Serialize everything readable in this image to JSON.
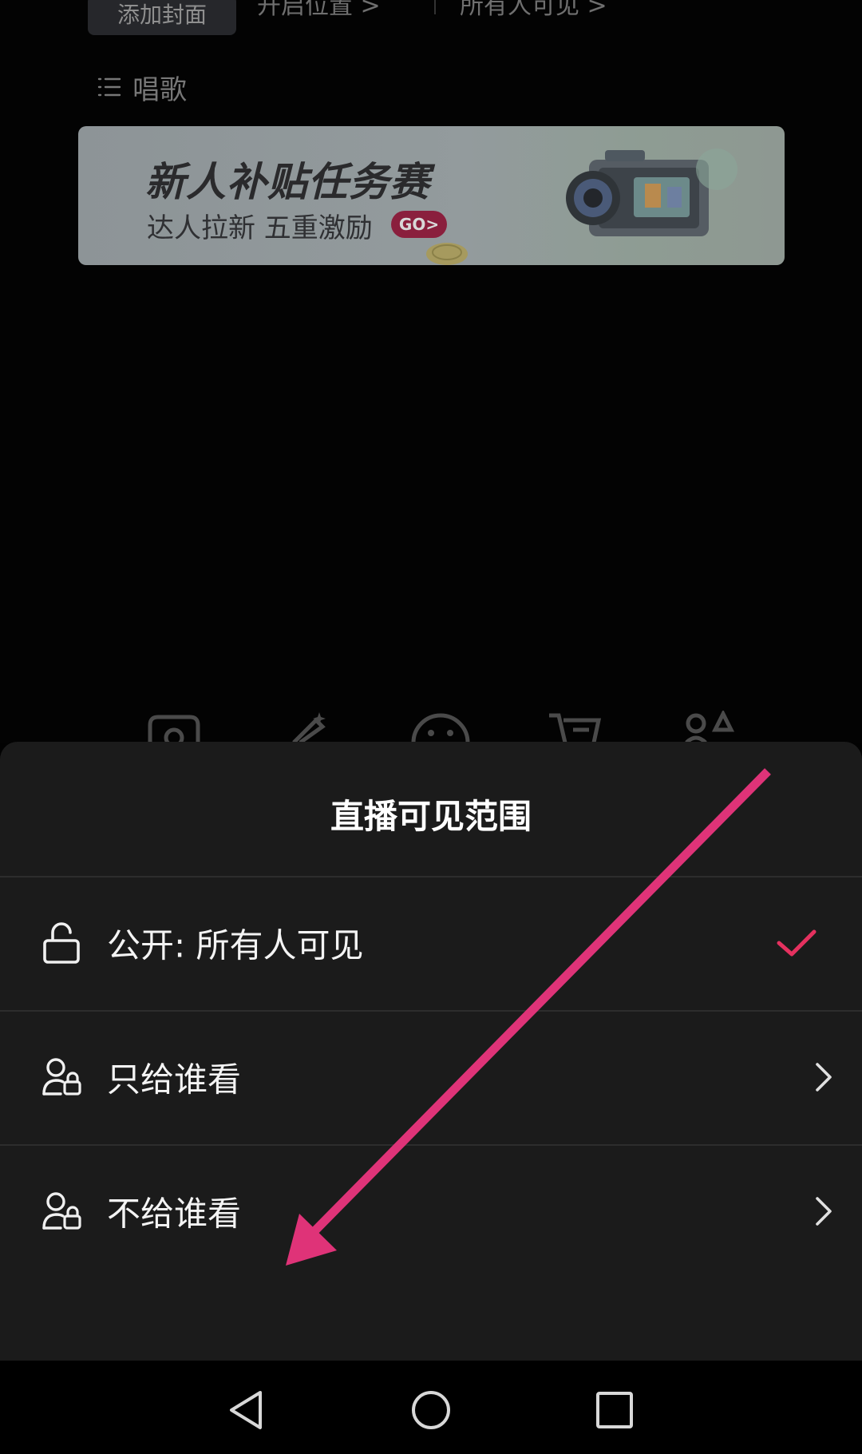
{
  "background": {
    "cover_tag": "添加封面",
    "location_link": "开启位置 >",
    "visibility_link": "所有人可见 >",
    "topic": {
      "icon": "list-icon",
      "label": "唱歌"
    },
    "banner": {
      "title": "新人补贴任务赛",
      "subtitle": "达人拉新 五重激励",
      "go_label": "GO>"
    },
    "toolbar_icons": [
      "camera-flip-icon",
      "beauty-wand-icon",
      "emoji-icon",
      "cart-icon",
      "people-icon"
    ]
  },
  "sheet": {
    "title": "直播可见范围",
    "options": [
      {
        "icon": "unlock-icon",
        "label": "公开: 所有人可见",
        "selected": true,
        "trailing": "check-icon"
      },
      {
        "icon": "user-lock-icon",
        "label": "只给谁看",
        "selected": false,
        "trailing": "chevron-right-icon"
      },
      {
        "icon": "user-lock-icon",
        "label": "不给谁看",
        "selected": false,
        "trailing": "chevron-right-icon"
      }
    ],
    "accent_color": "#e5315f"
  },
  "annotation": {
    "arrow_color": "#df3378"
  },
  "navbar": {
    "buttons": [
      "back-icon",
      "home-icon",
      "recents-icon"
    ]
  }
}
